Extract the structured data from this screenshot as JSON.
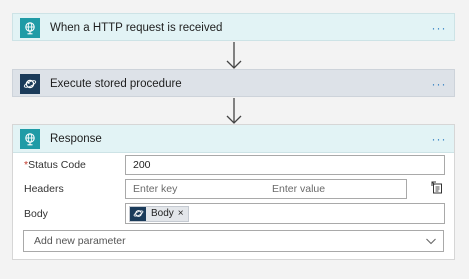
{
  "trigger": {
    "title": "When a HTTP request is received",
    "more": "···"
  },
  "stored_procedure": {
    "title": "Execute stored procedure",
    "more": "···"
  },
  "response": {
    "title": "Response",
    "more": "···",
    "status_code": {
      "required_mark": "*",
      "label": "Status Code",
      "value": "200"
    },
    "headers": {
      "label": "Headers",
      "key_placeholder": "Enter key",
      "value_placeholder": "Enter value"
    },
    "body": {
      "label": "Body",
      "token_label": "Body",
      "token_remove": "×"
    },
    "add_param": {
      "placeholder": "Add new parameter"
    }
  },
  "colors": {
    "teal": "#1f9ba6",
    "navy": "#1b3b5a",
    "link": "#2a7bbf"
  },
  "icons": [
    "http-globe-icon",
    "cosmos-db-icon",
    "more-options-icon",
    "switch-to-text-mode-icon",
    "chevron-down-icon",
    "arrow-down-icon"
  ]
}
